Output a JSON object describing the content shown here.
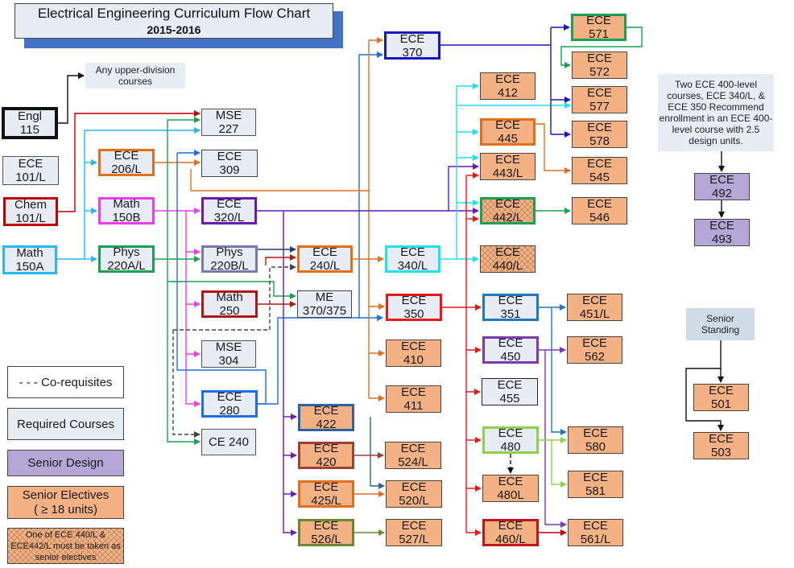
{
  "title": {
    "main": "Electrical Engineering Curriculum Flow Chart",
    "year": "2015-2016"
  },
  "colors": {
    "required_fill": "#e8ecf5",
    "elective_fill": "#f4b183",
    "design_fill": "#b4a7d6",
    "title_shadow": "#4472c4",
    "senior_standing_fill": "#d0dbe8"
  },
  "notes": {
    "upper_division": "Any upper-division courses",
    "design_prereq": "Two ECE 400-level courses, ECE 340/L, & ECE 350 Recommend enrollment in an ECE 400-level course with 2.5 design units.",
    "senior_standing": "Senior Standing"
  },
  "legend": {
    "corequisites": "- - - Co-requisites",
    "required": "Required Courses",
    "senior_design": "Senior Design",
    "senior_electives_line1": "Senior Electives",
    "senior_electives_line2": "( ≥ 18 units)",
    "one_of": "One of ECE 440/L & ECE442/L must be taken as senior electives"
  },
  "courses": [
    {
      "id": "engl115",
      "dept": "Engl",
      "num": "115",
      "type": "required"
    },
    {
      "id": "ece101",
      "dept": "ECE",
      "num": "101/L",
      "type": "required"
    },
    {
      "id": "chem101",
      "dept": "Chem",
      "num": "101/L",
      "type": "required"
    },
    {
      "id": "math150a",
      "dept": "Math",
      "num": "150A",
      "type": "required"
    },
    {
      "id": "ece206",
      "dept": "ECE",
      "num": "206/L",
      "type": "required"
    },
    {
      "id": "math150b",
      "dept": "Math",
      "num": "150B",
      "type": "required"
    },
    {
      "id": "phys220a",
      "dept": "Phys",
      "num": "220A/L",
      "type": "required"
    },
    {
      "id": "mse227",
      "dept": "MSE",
      "num": "227",
      "type": "required"
    },
    {
      "id": "ece309",
      "dept": "ECE",
      "num": "309",
      "type": "required"
    },
    {
      "id": "ece320",
      "dept": "ECE",
      "num": "320/L",
      "type": "required"
    },
    {
      "id": "phys220b",
      "dept": "Phys",
      "num": "220B/L",
      "type": "required"
    },
    {
      "id": "math250",
      "dept": "Math",
      "num": "250",
      "type": "required"
    },
    {
      "id": "mse304",
      "dept": "MSE",
      "num": "304",
      "type": "required"
    },
    {
      "id": "ece280",
      "dept": "ECE",
      "num": "280",
      "type": "required"
    },
    {
      "id": "ce240",
      "dept": "CE 240",
      "num": "",
      "type": "required"
    },
    {
      "id": "ece240",
      "dept": "ECE",
      "num": "240/L",
      "type": "required"
    },
    {
      "id": "me370",
      "dept": "ME",
      "num": "370/375",
      "type": "required"
    },
    {
      "id": "ece370",
      "dept": "ECE",
      "num": "370",
      "type": "required"
    },
    {
      "id": "ece340",
      "dept": "ECE",
      "num": "340/L",
      "type": "required"
    },
    {
      "id": "ece350",
      "dept": "ECE",
      "num": "350",
      "type": "required"
    },
    {
      "id": "ece410",
      "dept": "ECE",
      "num": "410",
      "type": "elective"
    },
    {
      "id": "ece411",
      "dept": "ECE",
      "num": "411",
      "type": "elective"
    },
    {
      "id": "ece422",
      "dept": "ECE",
      "num": "422",
      "type": "elective"
    },
    {
      "id": "ece420",
      "dept": "ECE",
      "num": "420",
      "type": "elective"
    },
    {
      "id": "ece425",
      "dept": "ECE",
      "num": "425/L",
      "type": "elective"
    },
    {
      "id": "ece526",
      "dept": "ECE",
      "num": "526/L",
      "type": "elective"
    },
    {
      "id": "ece524",
      "dept": "ECE",
      "num": "524/L",
      "type": "elective"
    },
    {
      "id": "ece520",
      "dept": "ECE",
      "num": "520/L",
      "type": "elective"
    },
    {
      "id": "ece527",
      "dept": "ECE",
      "num": "527/L",
      "type": "elective"
    },
    {
      "id": "ece412",
      "dept": "ECE",
      "num": "412",
      "type": "elective"
    },
    {
      "id": "ece445",
      "dept": "ECE",
      "num": "445",
      "type": "elective"
    },
    {
      "id": "ece443",
      "dept": "ECE",
      "num": "443/L",
      "type": "elective"
    },
    {
      "id": "ece442",
      "dept": "ECE",
      "num": "442/L",
      "type": "elective-hatched"
    },
    {
      "id": "ece440",
      "dept": "ECE",
      "num": "440/L",
      "type": "elective-hatched"
    },
    {
      "id": "ece351",
      "dept": "ECE",
      "num": "351",
      "type": "required"
    },
    {
      "id": "ece450",
      "dept": "ECE",
      "num": "450",
      "type": "required"
    },
    {
      "id": "ece455",
      "dept": "ECE",
      "num": "455",
      "type": "required"
    },
    {
      "id": "ece480",
      "dept": "ECE",
      "num": "480",
      "type": "required"
    },
    {
      "id": "ece480l",
      "dept": "ECE",
      "num": "480L",
      "type": "elective"
    },
    {
      "id": "ece460",
      "dept": "ECE",
      "num": "460/L",
      "type": "elective"
    },
    {
      "id": "ece571",
      "dept": "ECE",
      "num": "571",
      "type": "elective"
    },
    {
      "id": "ece572",
      "dept": "ECE",
      "num": "572",
      "type": "elective"
    },
    {
      "id": "ece577",
      "dept": "ECE",
      "num": "577",
      "type": "elective"
    },
    {
      "id": "ece578",
      "dept": "ECE",
      "num": "578",
      "type": "elective"
    },
    {
      "id": "ece545",
      "dept": "ECE",
      "num": "545",
      "type": "elective"
    },
    {
      "id": "ece546",
      "dept": "ECE",
      "num": "546",
      "type": "elective"
    },
    {
      "id": "ece451",
      "dept": "ECE",
      "num": "451/L",
      "type": "elective"
    },
    {
      "id": "ece562",
      "dept": "ECE",
      "num": "562",
      "type": "elective"
    },
    {
      "id": "ece580",
      "dept": "ECE",
      "num": "580",
      "type": "elective"
    },
    {
      "id": "ece581",
      "dept": "ECE",
      "num": "581",
      "type": "elective"
    },
    {
      "id": "ece561",
      "dept": "ECE",
      "num": "561/L",
      "type": "elective"
    },
    {
      "id": "ece492",
      "dept": "ECE",
      "num": "492",
      "type": "design"
    },
    {
      "id": "ece493",
      "dept": "ECE",
      "num": "493",
      "type": "design"
    },
    {
      "id": "ece501",
      "dept": "ECE",
      "num": "501",
      "type": "elective"
    },
    {
      "id": "ece503",
      "dept": "ECE",
      "num": "503",
      "type": "elective"
    }
  ]
}
